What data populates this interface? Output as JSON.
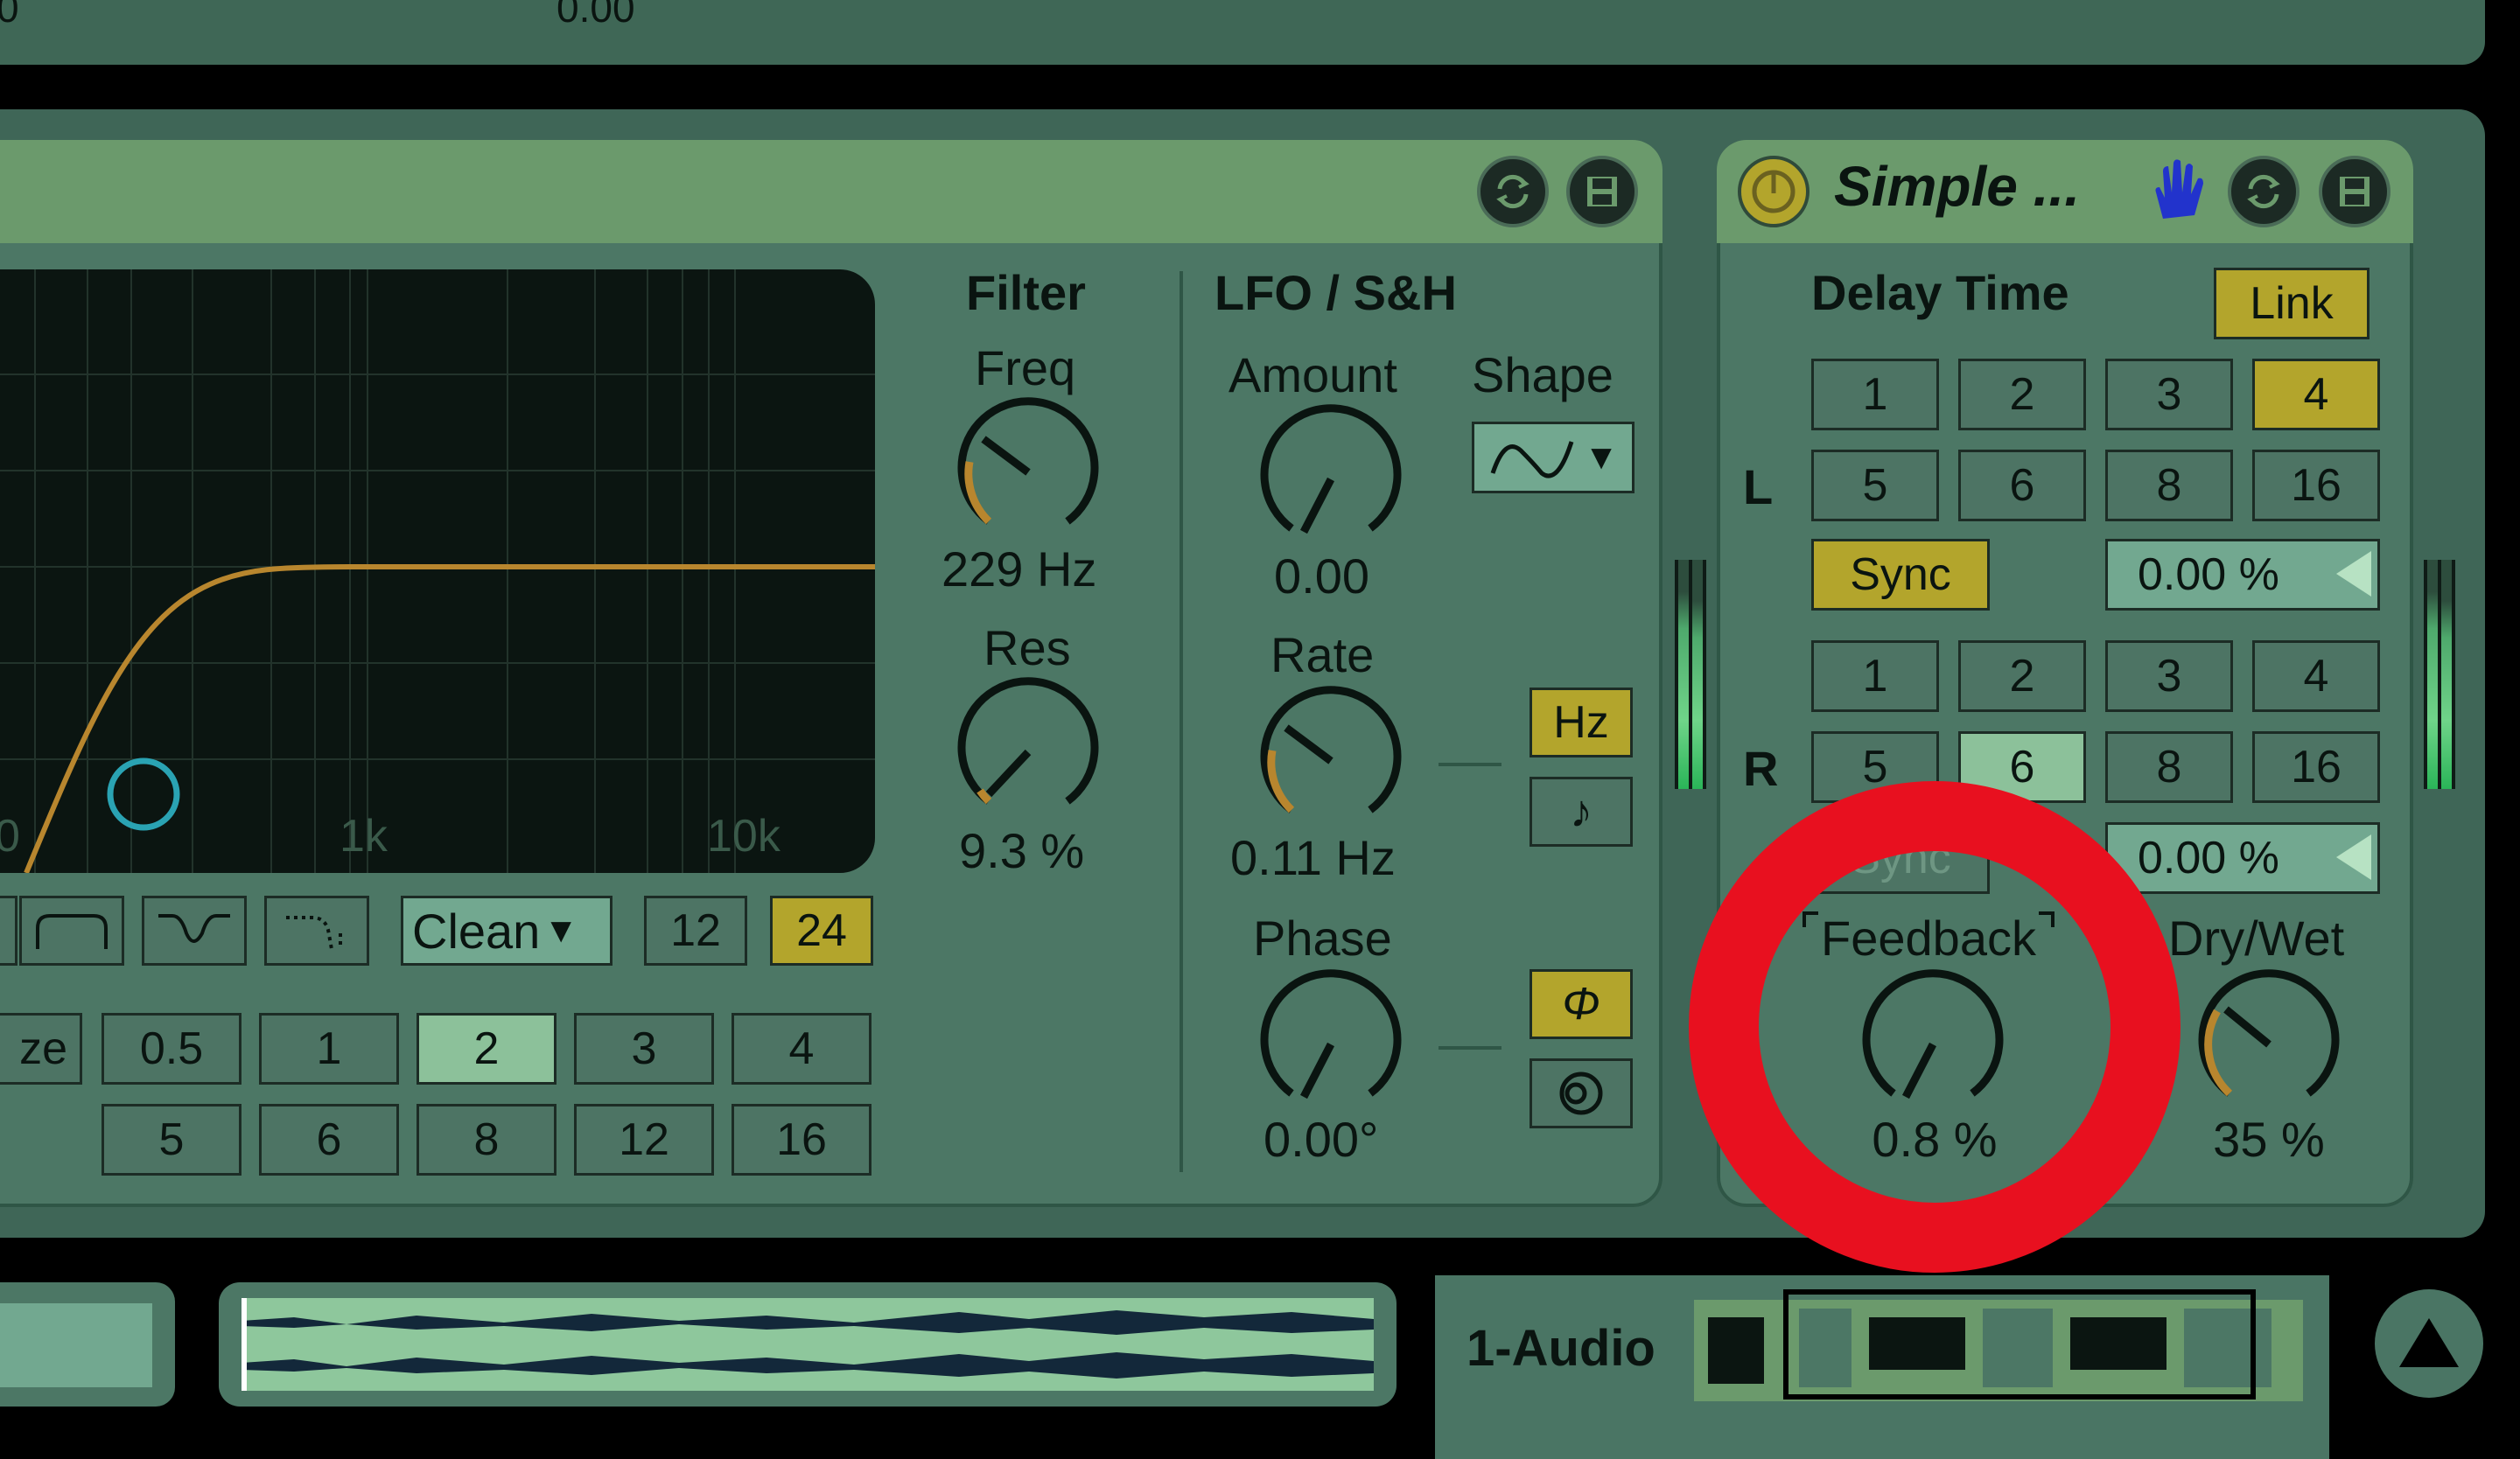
{
  "top_strip": {
    "left_value": "0",
    "mid_value": "0.00"
  },
  "auto_filter": {
    "display": {
      "tick_left": "0",
      "tick_1k": "1k",
      "tick_10k": "10k"
    },
    "filter_type_buttons": [
      "lowpass",
      "bandpass",
      "notch",
      "morph"
    ],
    "circuit": {
      "label": "Clean"
    },
    "slope_buttons": {
      "s12": "12",
      "s24": "24",
      "active": "24"
    },
    "quantize_label": "ze",
    "quantize_values": [
      "0.5",
      "1",
      "2",
      "3",
      "4",
      "5",
      "6",
      "8",
      "12",
      "16"
    ],
    "quantize_active": "2",
    "filter": {
      "title": "Filter",
      "freq": {
        "label": "Freq",
        "value": "229 Hz",
        "level": 0.3
      },
      "res": {
        "label": "Res",
        "value": "9.3 %",
        "level": 0.1
      }
    },
    "lfo": {
      "title": "LFO / S&H",
      "amount": {
        "label": "Amount",
        "value": "0.00",
        "level": 0
      },
      "shape": {
        "label": "Shape"
      },
      "rate": {
        "label": "Rate",
        "value": "0.11 Hz",
        "level": 0.3
      },
      "phase": {
        "label": "Phase",
        "value": "0.00°",
        "level": 0
      },
      "hz_button": "Hz",
      "note_button": "♪",
      "phase_button": "Φ",
      "spin_button": "spin"
    }
  },
  "simple_delay": {
    "title": "Simple ...",
    "delay_time": "Delay Time",
    "link": "Link",
    "l_label": "L",
    "r_label": "R",
    "beat_values": [
      "1",
      "2",
      "3",
      "4",
      "5",
      "6",
      "8",
      "16"
    ],
    "left_active": "4",
    "right_active": "6",
    "sync_label": "Sync",
    "left_offset": "0.00 %",
    "right_offset": "0.00 %",
    "feedback": {
      "label": "Feedback",
      "value": "0.8 %",
      "level": 0.01
    },
    "drywet": {
      "label": "Dry/Wet",
      "value": "35 %",
      "level": 0.35
    }
  },
  "bottom_bar": {
    "track_name": "1-Audio",
    "launch_icon": "triangle-up-icon"
  },
  "colors": {
    "device_bg": "#4c7765",
    "title_bar": "#6b9a6c",
    "active_yellow": "#b3a52c",
    "active_green": "#8cc19a",
    "curve": "#b8862e",
    "annotation": "#e8101f"
  }
}
